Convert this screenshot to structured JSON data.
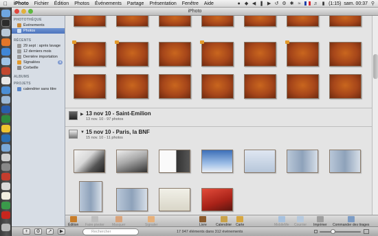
{
  "menubar": {
    "apple": "",
    "items": [
      "iPhoto",
      "Fichier",
      "Édition",
      "Photos",
      "Événements",
      "Partage",
      "Présentation",
      "Fenêtre",
      "Aide"
    ],
    "battery": "(1:15)",
    "clock": "sam. 00:37"
  },
  "window": {
    "title": "iPhoto"
  },
  "sidebar": {
    "library_head": "PHOTOTHÈQUE",
    "library": [
      {
        "label": "Événements",
        "icon": "events-icon",
        "color": "#c98a3a",
        "selected": false
      },
      {
        "label": "Photos",
        "icon": "photos-icon",
        "color": "#7a9ad0",
        "selected": true
      }
    ],
    "recent_head": "RÉCENTS",
    "recent": [
      {
        "label": "29 sept : après lavage",
        "icon": "event-icon",
        "color": "#9a9a9a"
      },
      {
        "label": "12 derniers mois",
        "icon": "calendar-icon",
        "color": "#9a9a9a"
      },
      {
        "label": "Dernière importation",
        "icon": "import-icon",
        "color": "#9a9a9a"
      },
      {
        "label": "Signalées",
        "icon": "flag-icon",
        "color": "#e39a2b",
        "badge": "6"
      },
      {
        "label": "Corbeille",
        "icon": "trash-icon",
        "color": "#8b8b8b"
      }
    ],
    "albums_head": "ALBUMS",
    "projects_head": "PROJETS",
    "projects": [
      {
        "label": "calendrier sans titre",
        "icon": "calendar-project-icon",
        "color": "#5a86c9"
      }
    ]
  },
  "events": [
    {
      "title": "13 nov 10 - Saint-Emilion",
      "subtitle": "13 nov. 10 - 97 photos"
    },
    {
      "title": "15 nov 10 - Paris, la BNF",
      "subtitle": "15 nov. 10 - 11 photos"
    }
  ],
  "toolbar": {
    "edit": "Édition",
    "rotate": "Faire pivoter",
    "hide": "Masquer",
    "flag": "Signaler",
    "book": "Livre",
    "calendar": "Calendrier",
    "card": "Carte",
    "mobileme": "MobileMe",
    "email": "Courrier",
    "print": "Imprimer",
    "order": "Commander des tirages"
  },
  "statusbar": {
    "search_placeholder": "Rechercher",
    "count": "17 947 éléments dans 312 événements"
  },
  "colors": {
    "selection": "#4d74bd",
    "flag": "#e39a2b"
  }
}
